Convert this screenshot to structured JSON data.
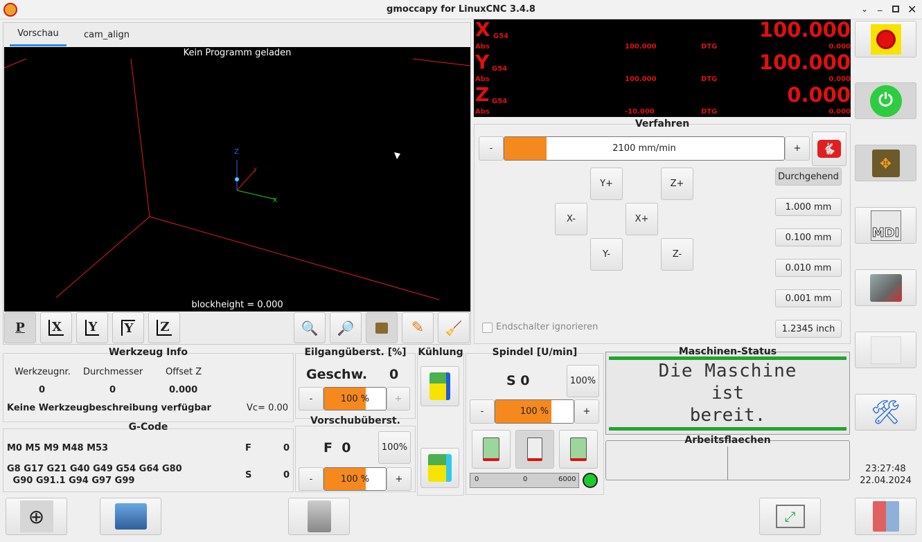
{
  "window": {
    "title": "gmoccapy for LinuxCNC  3.4.8"
  },
  "tabs": [
    {
      "label": "Vorschau"
    },
    {
      "label": "cam_align"
    }
  ],
  "preview": {
    "message": "Kein Programm geladen",
    "blockheight": "blockheight = 0.000",
    "axis_z": "Z",
    "axis_x": "X",
    "axis_y": "Y"
  },
  "view_buttons": [
    {
      "label": "P"
    },
    {
      "label": "X"
    },
    {
      "label": "Y"
    },
    {
      "label": "Y"
    },
    {
      "label": "Z"
    }
  ],
  "dro": {
    "axes": [
      {
        "letter": "X",
        "coord": "G54",
        "value": "100.000",
        "abs_label": "Abs",
        "abs": "100.000",
        "dtg_label": "DTG",
        "dtg": "0.000"
      },
      {
        "letter": "Y",
        "coord": "G54",
        "value": "100.000",
        "abs_label": "Abs",
        "abs": "100.000",
        "dtg_label": "DTG",
        "dtg": "0.000"
      },
      {
        "letter": "Z",
        "coord": "G54",
        "value": "0.000",
        "abs_label": "Abs",
        "abs": "-10.000",
        "dtg_label": "DTG",
        "dtg": "0.000"
      }
    ]
  },
  "jog": {
    "title": "Verfahren",
    "minus": "-",
    "plus": "+",
    "speed": "2100 mm/min",
    "speed_fraction": 0.15,
    "buttons": {
      "yplus": "Y+",
      "zplus": "Z+",
      "xminus": "X-",
      "xplus": "X+",
      "yminus": "Y-",
      "zminus": "Z-"
    },
    "increments": [
      "Durchgehend",
      "1.000 mm",
      "0.100 mm",
      "0.010 mm",
      "0.001 mm",
      "1.2345 inch"
    ],
    "ignore_limits": "Endschalter ignorieren"
  },
  "tool": {
    "title": "Werkzeug Info",
    "headers": [
      "Werkzeugnr.",
      "Durchmesser",
      "Offset Z"
    ],
    "values": [
      "0",
      "0",
      "0.000"
    ],
    "description": "Keine Werkzeugbeschreibung verfügbar",
    "vc": "Vc= 0.00"
  },
  "gcode": {
    "title": "G-Code",
    "line1": "M0 M5 M9 M48 M53",
    "line2a": "G8 G17 G21 G40 G49 G54 G64 G80",
    "line2b": " G90 G91.1 G94 G97 G99",
    "f_label": "F",
    "f_value": "0",
    "s_label": "S",
    "s_value": "0"
  },
  "rapid": {
    "title": "Eilgangüberst. [%]",
    "label": "Geschw.",
    "value": "0",
    "minus": "-",
    "plus": "+",
    "percent": "100 %",
    "fraction": 0.67
  },
  "feed": {
    "title": "Vorschubüberst.",
    "label": "F  0",
    "reset": "100%",
    "minus": "-",
    "plus": "+",
    "percent": "100 %",
    "fraction": 0.67
  },
  "coolant": {
    "title": "Kühlung"
  },
  "spindle": {
    "title": "Spindel [U/min]",
    "label": "S 0",
    "reset": "100%",
    "minus": "-",
    "plus": "+",
    "percent": "100 %",
    "fraction": 0.72,
    "bar_min": "0",
    "bar_val": "0",
    "bar_max": "6000"
  },
  "status": {
    "title": "Maschinen-Status",
    "lines": [
      "Die Maschine",
      "ist",
      "bereit."
    ]
  },
  "workarea": {
    "title": "Arbeitsflaechen"
  },
  "clock": {
    "time": "23:27:48",
    "date": "22.04.2024"
  },
  "side_buttons": {
    "mdi_label": "MDI"
  },
  "colors": {
    "accent": "#f5891e",
    "dro_red": "#e01010",
    "status_green": "#1fa52f",
    "estop_yellow": "#f6e300"
  }
}
